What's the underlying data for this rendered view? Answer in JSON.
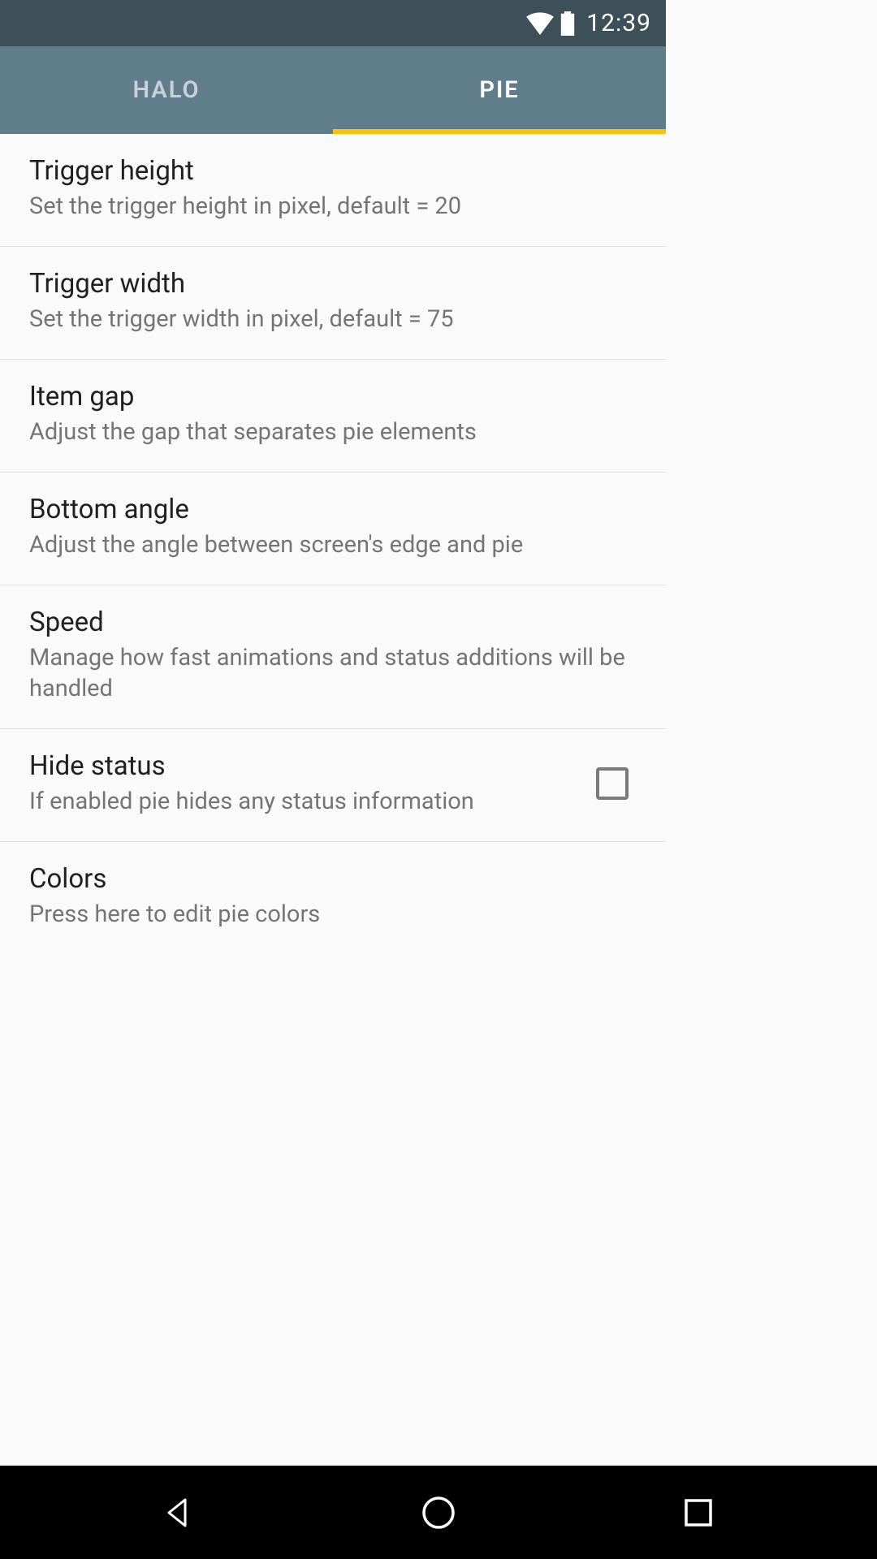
{
  "status_bar": {
    "time": "12:39"
  },
  "tabs": [
    {
      "label": "HALO",
      "active": false
    },
    {
      "label": "PIE",
      "active": true
    }
  ],
  "settings": [
    {
      "key": "trigger-height",
      "title": "Trigger height",
      "sub": "Set the trigger height in pixel, default = 20",
      "type": "link"
    },
    {
      "key": "trigger-width",
      "title": "Trigger width",
      "sub": "Set the trigger width in pixel, default = 75",
      "type": "link"
    },
    {
      "key": "item-gap",
      "title": "Item gap",
      "sub": "Adjust the gap that separates pie elements",
      "type": "link"
    },
    {
      "key": "bottom-angle",
      "title": "Bottom angle",
      "sub": "Adjust the angle between screen's edge and pie",
      "type": "link"
    },
    {
      "key": "speed",
      "title": "Speed",
      "sub": "Manage how fast animations and status additions will be handled",
      "type": "link"
    },
    {
      "key": "hide-status",
      "title": "Hide status",
      "sub": "If enabled pie hides any status information",
      "type": "checkbox",
      "checked": false
    },
    {
      "key": "colors",
      "title": "Colors",
      "sub": "Press here to edit pie colors",
      "type": "link"
    }
  ],
  "colors": {
    "status_bar_bg": "#3d4f58",
    "tab_bar_bg": "#607d8b",
    "tab_indicator": "#ffc107",
    "text_primary": "#202020",
    "text_secondary": "#757575"
  }
}
